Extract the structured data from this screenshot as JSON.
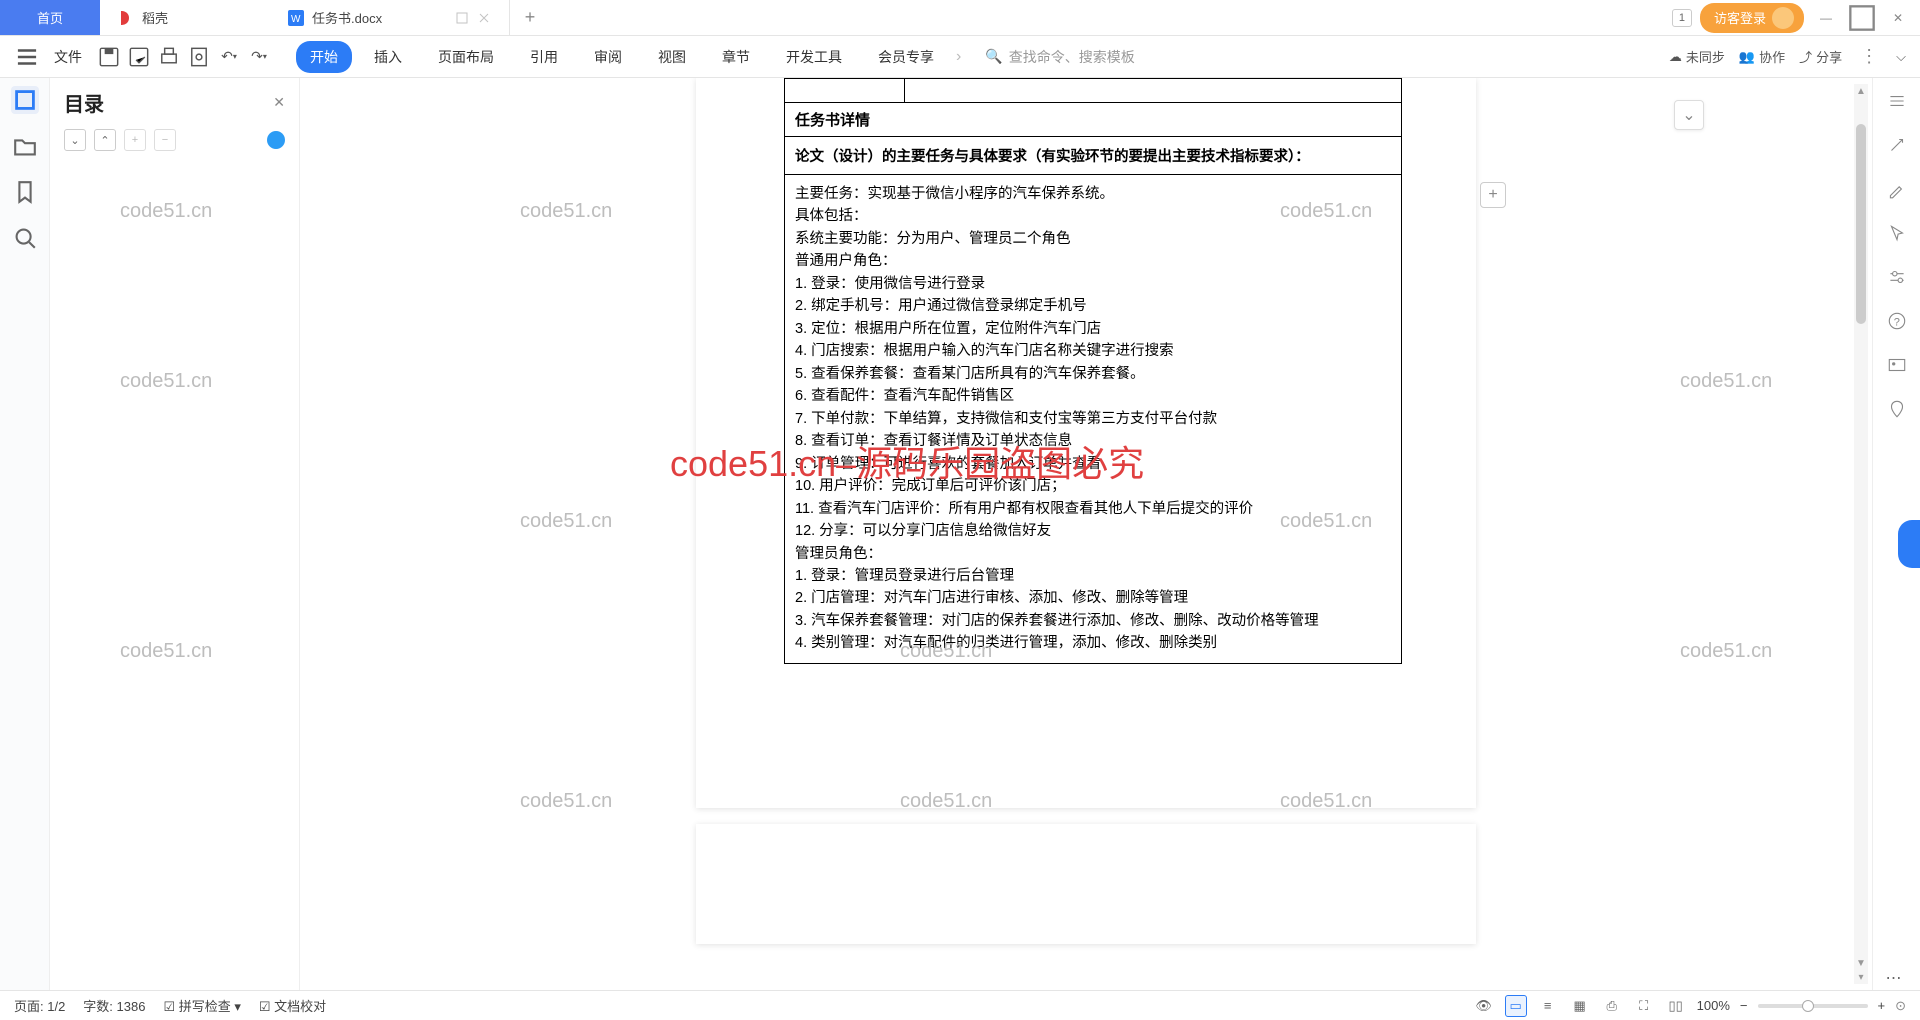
{
  "tabs": {
    "home": "首页",
    "app": "稻壳",
    "doc": "任务书.docx"
  },
  "titlebar": {
    "badge": "1",
    "login": "访客登录"
  },
  "menubar": {
    "file": "文件",
    "items": [
      "开始",
      "插入",
      "页面布局",
      "引用",
      "审阅",
      "视图",
      "章节",
      "开发工具",
      "会员专享"
    ],
    "search_placeholder": "查找命令、搜索模板",
    "unsync": "未同步",
    "collab": "协作",
    "share": "分享"
  },
  "outline": {
    "title": "目录"
  },
  "doc": {
    "row_header": "任务书详情",
    "section_header": "论文（设计）的主要任务与具体要求（有实验环节的要提出主要技术指标要求）：",
    "lines": [
      "主要任务：实现基于微信小程序的汽车保养系统。",
      "具体包括：",
      "系统主要功能：分为用户、管理员二个角色",
      "普通用户角色：",
      "1. 登录：使用微信号进行登录",
      "2. 绑定手机号：用户通过微信登录绑定手机号",
      "3. 定位：根据用户所在位置，定位附件汽车门店",
      "4. 门店搜索：根据用户输入的汽车门店名称关键字进行搜索",
      "5. 查看保养套餐：查看某门店所具有的汽车保养套餐。",
      "6. 查看配件：查看汽车配件销售区",
      "7. 下单付款：下单结算，支持微信和支付宝等第三方支付平台付款",
      "8. 查看订单：查看订餐详情及订单状态信息",
      "9. 订单管理：可进行喜欢的套餐加入订单并查看",
      "10. 用户评价：完成订单后可评价该门店；",
      "11. 查看汽车门店评价：所有用户都有权限查看其他人下单后提交的评价",
      "12. 分享：可以分享门店信息给微信好友",
      "管理员角色：",
      "1. 登录：管理员登录进行后台管理",
      "2. 门店管理：对汽车门店进行审核、添加、修改、删除等管理",
      "3. 汽车保养套餐管理：对门店的保养套餐进行添加、修改、删除、改动价格等管理",
      "4. 类别管理：对汽车配件的归类进行管理，添加、修改、删除类别"
    ]
  },
  "status": {
    "page": "页面: 1/2",
    "words": "字数: 1386",
    "spell": "拼写检查",
    "check": "文档校对",
    "zoom": "100%"
  },
  "watermark": {
    "small": "code51.cn",
    "big": "code51.cn–源码乐园盗图必究"
  }
}
